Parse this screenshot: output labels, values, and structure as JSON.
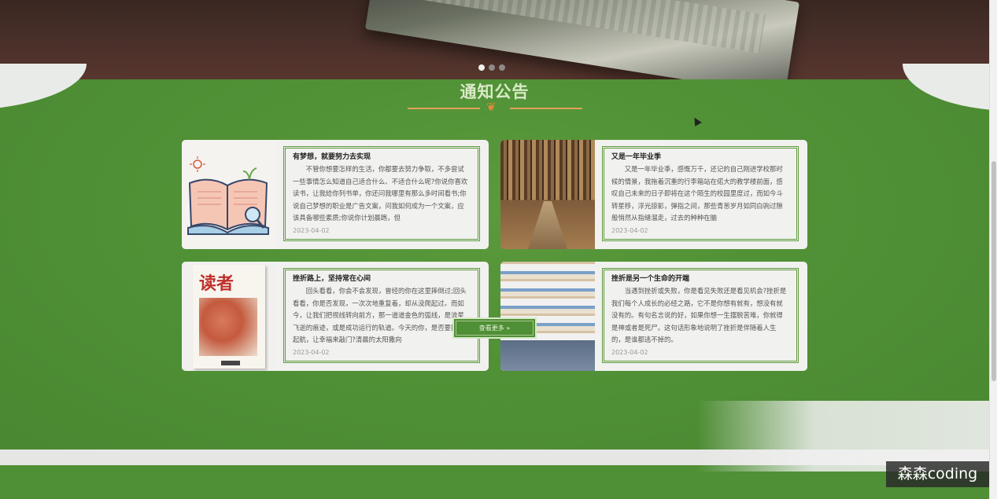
{
  "banner": {
    "slides": 3,
    "active_slide": 1
  },
  "notice": {
    "title": "通知公告",
    "items": [
      {
        "title": "有梦想，就要努力去实现",
        "text": "不管你想要怎样的生活，你都要去努力争取，不多尝试一些事情怎么知道自己适合什么、不适合什么呢?你说你喜欢读书，让我给你列书单，你还问我哪里有那么多时间看书;你说自己梦想的职业是广告文案，问我如何成为一个文案，应该具备哪些素质;你说你计划晨跑，但",
        "date": "2023-04-02",
        "thumb": "open-book-illustration"
      },
      {
        "title": "又是一年毕业季",
        "text": "又是一年毕业季，感慨万千，还记的自己刚进学校那时候的情景，我拖着沉重的行李箱站在偌大的教学楼前面，感叹自己未来的日子即将在这个陌生的校园里度过，而如今斗转星移，浮光掠影，弹指之间，那些青葱岁月如同白驹过隙般悄然从指缝溜走，过去的种种在脑",
        "date": "2023-04-02",
        "thumb": "library-shelves-photo"
      },
      {
        "title": "挫折路上，坚持常在心间",
        "text": "回头看看，你会不会发现，曾经的你在这里摔倒过;回头看看，你是否发现，一次次地重复着，却从没爬起过。而如今，让我们把视线转向前方，那一道道金色的弧线，是流星飞逝的痕迹，或是成功运行的轨道。今天的你，是否要扬帆起航，让幸福来敲门?清晨的太阳撒向",
        "date": "2023-04-02",
        "thumb": "magazine-cover",
        "thumb_text": "读者"
      },
      {
        "title": "挫折是另一个生命的开端",
        "text": "当遇到挫折或失败，你是看见失败还是看见机会?挫折是我们每个人成长的必经之路，它不是你想有就有，想没有就没有的。有句名言说的好，如果你想一生摆脱苦难，你就得是神或者是死尸。这句话形象地说明了挫折是伴随着人生的，是谁都逃不掉的。",
        "date": "2023-04-02",
        "thumb": "library-bookshelves-photo"
      }
    ],
    "more_label": "查看更多 »"
  },
  "watermark": "森森coding",
  "colors": {
    "section_green": "#4f8f35",
    "title_color": "#d9e9c7",
    "accent_orange": "#e38a3c"
  }
}
